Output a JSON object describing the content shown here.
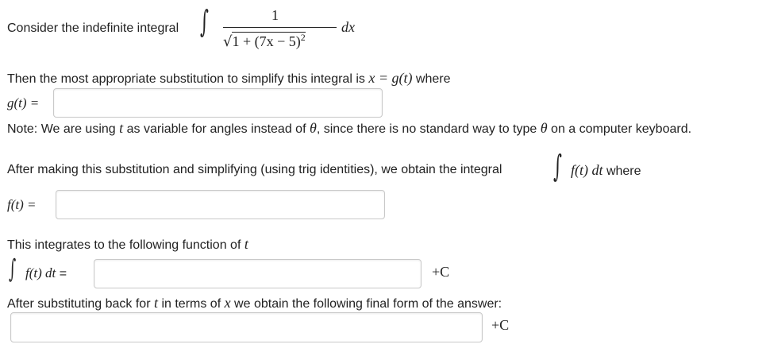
{
  "intro": {
    "text": "Consider the indefinite integral",
    "integrand": {
      "numerator": "1",
      "denominator_sqrt": "1 + (7x − 5)",
      "exponent": "2",
      "differential": "dx"
    }
  },
  "step1": {
    "prefix": "Then the most appropriate substitution to simplify this integral is",
    "equation": "x = g(t)",
    "suffix": "where",
    "label": "g(t) =",
    "value": ""
  },
  "note": {
    "part1": "Note: We are using",
    "var": "t",
    "part2": "as variable for angles instead of",
    "theta": "θ",
    "part3": ", since there is no standard way to type",
    "theta2": "θ",
    "part4": "on a computer keyboard."
  },
  "step2": {
    "prefix": "After making this substitution and simplifying (using trig identities), we obtain the integral",
    "expr": "f(t) dt",
    "suffix": "where",
    "label": "f(t) =",
    "value": ""
  },
  "step3": {
    "prefix": "This integrates to the following function of",
    "var": "t",
    "label_expr": "f(t) dt",
    "label_eq": "=",
    "value": "",
    "constant": "+C"
  },
  "step4": {
    "part1": "After substituting back for",
    "var_t": "t",
    "part2": "in terms of",
    "var_x": "x",
    "part3": "we obtain the following final form of the answer:",
    "value": "",
    "constant": "+C"
  }
}
